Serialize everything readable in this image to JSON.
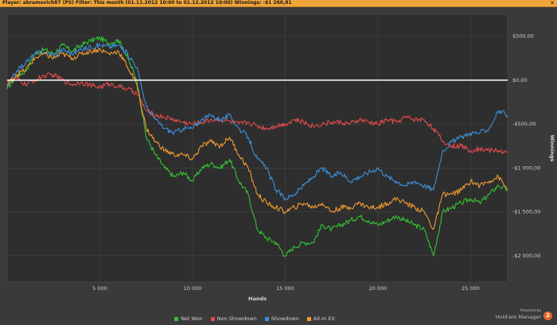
{
  "header": {
    "title": "Player: abramovich87 (PS) Filter: This month (01.11.2012 10:00 to 01.12.2012 10:00) Winnings: -$1 260,81",
    "close_glyph": "✕"
  },
  "branding": {
    "powered_by": "Powered by",
    "name": "Hold'em Manager",
    "logo_text": "2"
  },
  "colors": {
    "background": "#3a3a3a",
    "plot_bg": "#2e2e2e",
    "header_bg": "#f0a53a",
    "zero_line": "#ffffff"
  },
  "chart_data": {
    "type": "line",
    "title": "",
    "xlabel": "Hands",
    "ylabel": "Winnings",
    "xlim": [
      0,
      27000
    ],
    "ylim": [
      -2300,
      750
    ],
    "x_ticks": [
      {
        "value": 5000,
        "label": "5 000"
      },
      {
        "value": 10000,
        "label": "10 000"
      },
      {
        "value": 15000,
        "label": "15 000"
      },
      {
        "value": 20000,
        "label": "20 000"
      },
      {
        "value": 25000,
        "label": "25 000"
      }
    ],
    "y_ticks": [
      {
        "value": 500,
        "label": "$500,00"
      },
      {
        "value": 0,
        "label": "$0,00"
      },
      {
        "value": -500,
        "label": "-$500,00"
      },
      {
        "value": -1000,
        "label": "-$1 000,00"
      },
      {
        "value": -1500,
        "label": "-$1 500,00"
      },
      {
        "value": -2000,
        "label": "-$2 000,00"
      }
    ],
    "grid": true,
    "legend_position": "bottom",
    "x": [
      0,
      500,
      1000,
      1500,
      2000,
      2500,
      3000,
      3500,
      4000,
      4500,
      5000,
      5500,
      6000,
      6500,
      7000,
      7500,
      8000,
      8500,
      9000,
      9500,
      10000,
      10500,
      11000,
      11500,
      12000,
      12500,
      13000,
      13500,
      14000,
      14500,
      15000,
      15500,
      16000,
      16500,
      17000,
      17500,
      18000,
      18500,
      19000,
      19500,
      20000,
      20500,
      21000,
      21500,
      22000,
      22500,
      23000,
      23500,
      24000,
      24500,
      25000,
      25500,
      26000,
      26500,
      27000
    ],
    "series": [
      {
        "name": "Net Won",
        "color": "#34c232",
        "values": [
          -100,
          50,
          100,
          300,
          350,
          300,
          400,
          330,
          400,
          450,
          480,
          420,
          460,
          250,
          0,
          -650,
          -850,
          -1000,
          -1100,
          -1050,
          -1150,
          -1000,
          -950,
          -1000,
          -900,
          -1150,
          -1300,
          -1700,
          -1800,
          -1850,
          -2000,
          -1900,
          -1850,
          -1850,
          -1650,
          -1700,
          -1650,
          -1600,
          -1550,
          -1600,
          -1650,
          -1600,
          -1550,
          -1600,
          -1650,
          -1700,
          -2000,
          -1500,
          -1450,
          -1400,
          -1350,
          -1400,
          -1300,
          -1200,
          -1250
        ]
      },
      {
        "name": "Non Showdown",
        "color": "#e24b4b",
        "values": [
          0,
          20,
          -50,
          0,
          50,
          60,
          0,
          -50,
          -20,
          -60,
          -80,
          -40,
          -70,
          -100,
          -150,
          -350,
          -400,
          -420,
          -450,
          -480,
          -500,
          -480,
          -450,
          -450,
          -470,
          -500,
          -480,
          -520,
          -550,
          -520,
          -500,
          -450,
          -480,
          -520,
          -500,
          -480,
          -480,
          -500,
          -450,
          -480,
          -500,
          -450,
          -480,
          -420,
          -450,
          -450,
          -550,
          -700,
          -750,
          -750,
          -800,
          -780,
          -800,
          -800,
          -830
        ]
      },
      {
        "name": "Showdown",
        "color": "#3a8fd8",
        "values": [
          -80,
          100,
          200,
          300,
          320,
          280,
          350,
          300,
          350,
          380,
          400,
          380,
          400,
          300,
          150,
          -300,
          -450,
          -550,
          -600,
          -550,
          -550,
          -450,
          -400,
          -450,
          -400,
          -550,
          -650,
          -900,
          -1000,
          -1250,
          -1350,
          -1300,
          -1200,
          -1100,
          -1000,
          -1100,
          -1050,
          -1150,
          -1100,
          -1050,
          -1000,
          -1100,
          -1150,
          -1200,
          -1150,
          -1200,
          -1250,
          -800,
          -700,
          -650,
          -600,
          -600,
          -550,
          -350,
          -400
        ]
      },
      {
        "name": "All-In EV",
        "color": "#f09a30",
        "values": [
          -60,
          60,
          120,
          250,
          300,
          250,
          300,
          250,
          300,
          330,
          350,
          300,
          330,
          150,
          -50,
          -550,
          -700,
          -800,
          -850,
          -850,
          -900,
          -750,
          -700,
          -750,
          -650,
          -850,
          -1000,
          -1300,
          -1400,
          -1450,
          -1500,
          -1450,
          -1400,
          -1450,
          -1400,
          -1500,
          -1450,
          -1450,
          -1400,
          -1450,
          -1450,
          -1400,
          -1350,
          -1400,
          -1450,
          -1500,
          -1700,
          -1300,
          -1300,
          -1250,
          -1150,
          -1200,
          -1150,
          -1100,
          -1250
        ]
      }
    ]
  }
}
